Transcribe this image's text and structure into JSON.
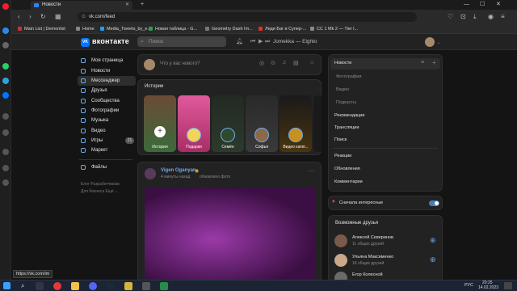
{
  "browser": {
    "tab_title": "Новости",
    "url": "vk.com/feed",
    "bookmarks": [
      "Main List | Demonlist",
      "Home",
      "Media_Tweets_by_e...",
      "Новая таблица - G...",
      "Geometry Dash Im...",
      "Леди Баг и Супер-...",
      "CC 1 Mk 2 — Tier l..."
    ],
    "status_url": "https://vk.com/im"
  },
  "header": {
    "logo_text": "вконтакте",
    "logo_mark": "VK",
    "search_placeholder": "Поиск",
    "player_track": "Jomekka — Eighto"
  },
  "left_nav": [
    {
      "label": "Моя страница",
      "icon": "user-icon"
    },
    {
      "label": "Новости",
      "icon": "news-icon"
    },
    {
      "label": "Мессенджер",
      "icon": "message-icon"
    },
    {
      "label": "Друзья",
      "icon": "friends-icon"
    },
    {
      "label": "Сообщества",
      "icon": "groups-icon"
    },
    {
      "label": "Фотографии",
      "icon": "photo-icon"
    },
    {
      "label": "Музыка",
      "icon": "music-icon"
    },
    {
      "label": "Видео",
      "icon": "video-icon"
    },
    {
      "label": "Игры",
      "icon": "games-icon",
      "badge": "21"
    },
    {
      "label": "Маркет",
      "icon": "market-icon"
    },
    {
      "label": "Файлы",
      "icon": "files-icon"
    }
  ],
  "left_footer": {
    "line1": "Блог   Разработчикам",
    "line2": "Для бизнеса   Ещё ⌄"
  },
  "composer": {
    "placeholder": "Что у вас нового?"
  },
  "stories": {
    "title": "Истории",
    "items": [
      {
        "label": "История",
        "bg": "#3a6b3a"
      },
      {
        "label": "Подарки",
        "bg": "#c2447c"
      },
      {
        "label": "Семён",
        "bg": "#2c3a2c"
      },
      {
        "label": "Софья",
        "bg": "#3a3a3a"
      },
      {
        "label": "Видео катег...",
        "bg": "#4a3410"
      },
      {
        "label": "",
        "bg": "#1a1a1a"
      }
    ]
  },
  "post": {
    "author": "Vigen Oganyan",
    "time": "4 минуты назад",
    "action": "обновлено фото",
    "image_color": "#6a1f72"
  },
  "right_menu": {
    "main": "Новости",
    "sub": [
      "Фотографии",
      "Видео",
      "Подкасты"
    ],
    "items": [
      "Рекомендации",
      "Трансляции",
      "Поиск"
    ],
    "items2": [
      "Реакции",
      "Обновления",
      "Комментарии"
    ]
  },
  "sort_toggle": {
    "label": "Сначала интересные",
    "on": true
  },
  "friends": {
    "title": "Возможные друзья",
    "items": [
      {
        "name": "Алексей Северинов",
        "mutual": "11 общих друзей"
      },
      {
        "name": "Ульяна Максименко",
        "mutual": "18 общих друзей"
      },
      {
        "name": "Егор Колесной",
        "mutual": ""
      }
    ]
  },
  "taskbar": {
    "lang": "РУС",
    "time": "20:25",
    "date": "14.02.2023"
  },
  "colors": {
    "accent": "#71aaeb",
    "vk_blue": "#0077ff",
    "bg": "#141414",
    "card": "#222222"
  }
}
